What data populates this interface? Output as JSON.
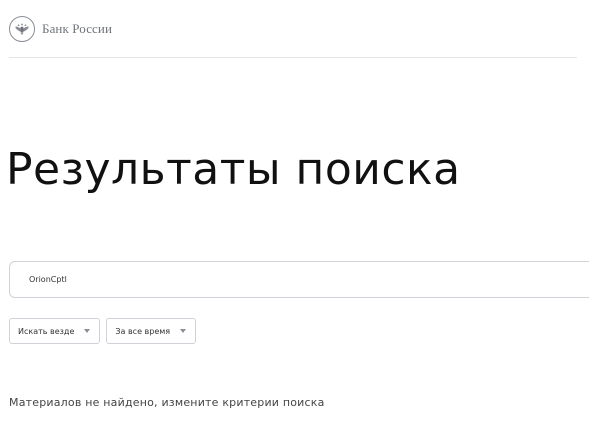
{
  "header": {
    "logo_icon": "bank-of-russia-eagle-icon",
    "logo_text": "Банк России"
  },
  "page": {
    "title": "Результаты поиска"
  },
  "search": {
    "value": "OrionCptl"
  },
  "filters": [
    {
      "label": "Искать везде",
      "icon": "chevron-down-icon"
    },
    {
      "label": "За все время",
      "icon": "chevron-down-icon"
    }
  ],
  "results": {
    "empty_message": "Материалов не найдено, измените критерии поиска"
  }
}
